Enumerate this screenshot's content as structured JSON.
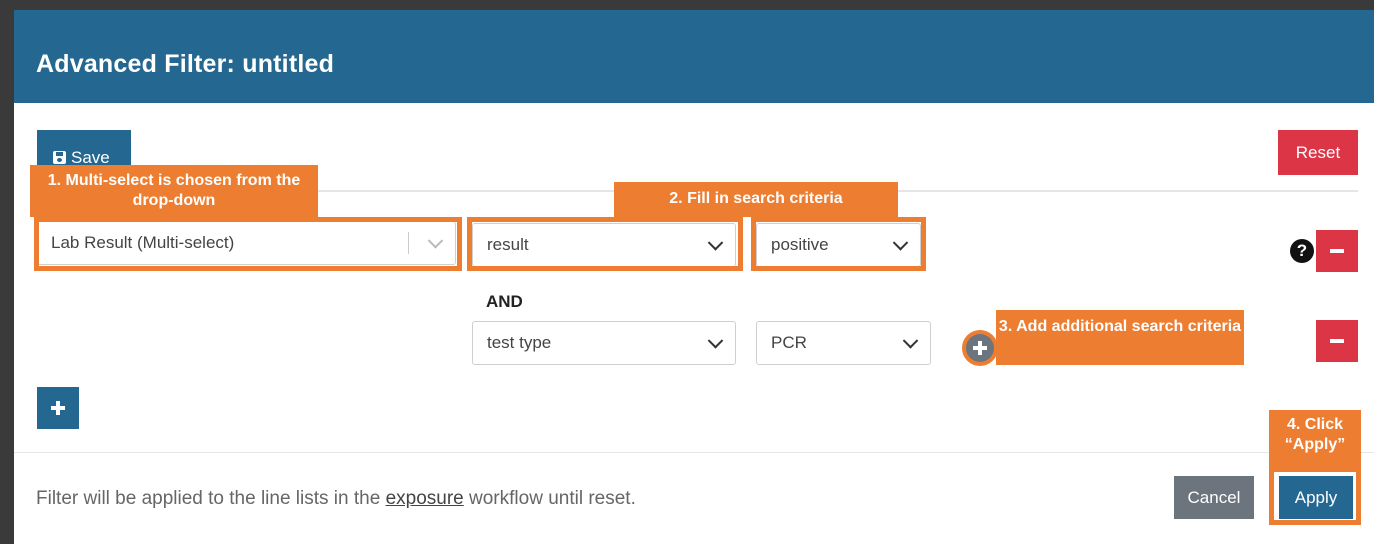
{
  "modal": {
    "title": "Advanced Filter: untitled"
  },
  "toolbar": {
    "save_label": "Save",
    "reset_label": "Reset"
  },
  "filter_row": {
    "field_select": "Lab Result (Multi-select)",
    "criteria": [
      {
        "field": "result",
        "value": "positive"
      },
      {
        "field": "test type",
        "value": "PCR"
      }
    ],
    "and_label": "AND",
    "help_symbol": "?"
  },
  "footer": {
    "text_before": "Filter will be applied to the line lists in the ",
    "link": "exposure",
    "text_after": " workflow until reset.",
    "cancel_label": "Cancel",
    "apply_label": "Apply"
  },
  "annotations": {
    "step1": "1. Multi-select is chosen from the drop-down",
    "step2": "2. Fill in search criteria",
    "step3": "3. Add additional search criteria",
    "step4": "4. Click “Apply”"
  },
  "colors": {
    "primary": "#246891",
    "danger": "#dc3545",
    "secondary": "#6c757d",
    "annotation": "#ed7d31"
  },
  "icons": [
    "save-icon",
    "chevron-down-icon",
    "question-circle-icon",
    "minus-icon",
    "plus-circle-icon",
    "plus-icon"
  ]
}
